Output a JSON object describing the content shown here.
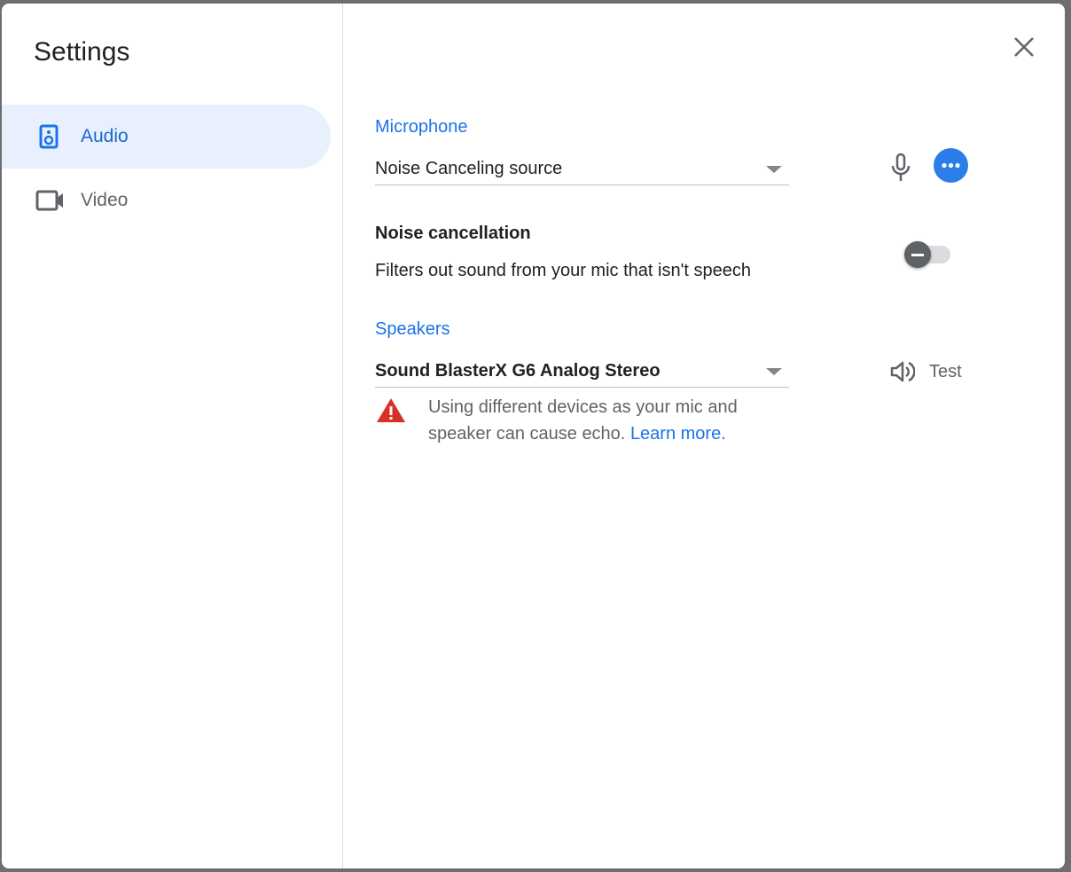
{
  "settings": {
    "title": "Settings",
    "nav": [
      {
        "label": "Audio",
        "icon": "speaker-icon"
      },
      {
        "label": "Video",
        "icon": "videocam-icon"
      }
    ]
  },
  "microphone": {
    "label": "Microphone",
    "selected": "Noise Canceling source"
  },
  "noise": {
    "title": "Noise cancellation",
    "description": "Filters out sound from your mic that isn't speech",
    "enabled": false
  },
  "speakers": {
    "label": "Speakers",
    "selected": "Sound BlasterX G6 Analog Stereo",
    "test_label": "Test",
    "warning": {
      "line1": "Using different devices as your mic and",
      "line2": "speaker can cause echo.",
      "link": "Learn more."
    }
  },
  "colors": {
    "accent": "#1a73e8",
    "warning": "#d93025"
  }
}
